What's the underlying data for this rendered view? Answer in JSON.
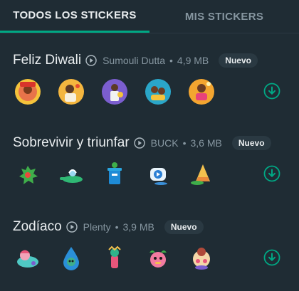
{
  "tabs": [
    {
      "label": "TODOS LOS STICKERS",
      "active": true
    },
    {
      "label": "MIS STICKERS",
      "active": false
    }
  ],
  "colors": {
    "accent": "#00a884",
    "background": "#1f2c34",
    "muted": "#8696a0"
  },
  "packs": [
    {
      "title": "Feliz Diwali",
      "author": "Sumouli Dutta",
      "separator": "•",
      "size": "4,9 MB",
      "badge": "Nuevo",
      "stickers": [
        "diwali-sticker-1",
        "diwali-sticker-2",
        "diwali-sticker-3",
        "diwali-sticker-4",
        "diwali-sticker-5"
      ]
    },
    {
      "title": "Sobrevivir y triunfar",
      "author": "BUCK",
      "separator": "•",
      "size": "3,6 MB",
      "badge": "Nuevo",
      "stickers": [
        "survive-sticker-1",
        "survive-sticker-2",
        "survive-sticker-3",
        "survive-sticker-4",
        "survive-sticker-5"
      ]
    },
    {
      "title": "Zodíaco",
      "author": "Plenty",
      "separator": "•",
      "size": "3,9 MB",
      "badge": "Nuevo",
      "stickers": [
        "zodiac-sticker-1",
        "zodiac-sticker-2",
        "zodiac-sticker-3",
        "zodiac-sticker-4",
        "zodiac-sticker-5"
      ]
    }
  ]
}
